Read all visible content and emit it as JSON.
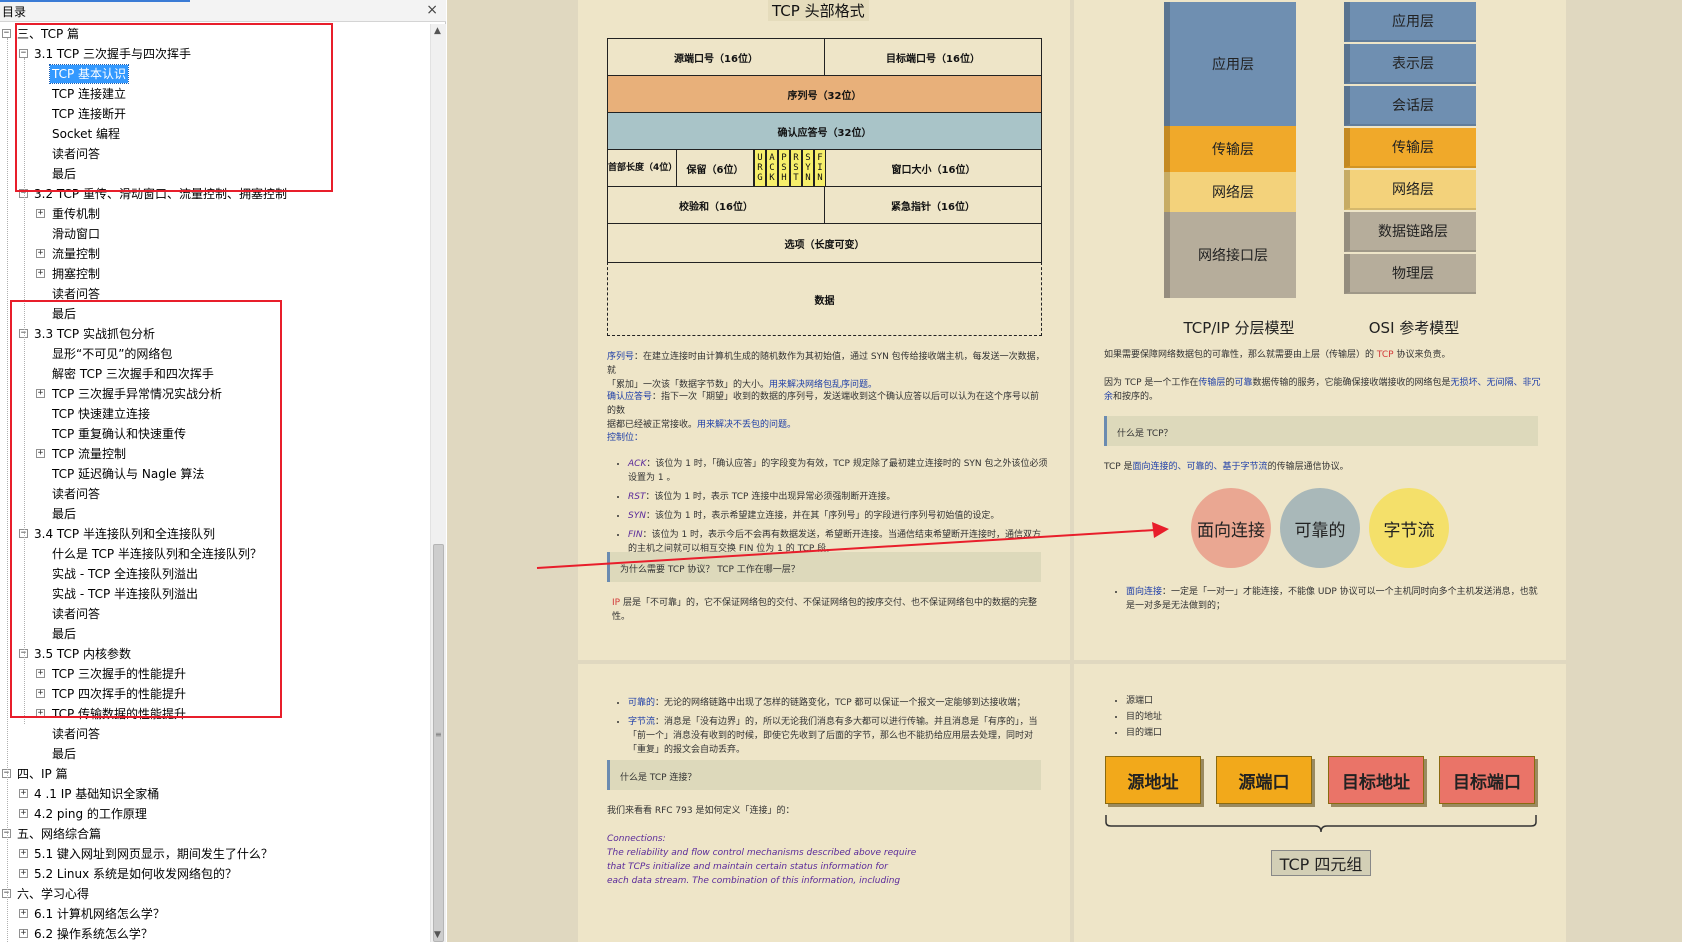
{
  "toc": {
    "title": "目录",
    "close": "×",
    "items": [
      {
        "id": "n0",
        "label": "三、TCP 篇",
        "level": 0,
        "exp": "−"
      },
      {
        "id": "n1",
        "label": "3.1 TCP 三次握手与四次挥手",
        "level": 1,
        "exp": "−"
      },
      {
        "id": "n2",
        "label": "TCP 基本认识",
        "level": 2,
        "exp": "",
        "selected": true
      },
      {
        "id": "n3",
        "label": "TCP 连接建立",
        "level": 2,
        "exp": ""
      },
      {
        "id": "n4",
        "label": "TCP 连接断开",
        "level": 2,
        "exp": ""
      },
      {
        "id": "n5",
        "label": "Socket 编程",
        "level": 2,
        "exp": ""
      },
      {
        "id": "n6",
        "label": "读者问答",
        "level": 2,
        "exp": ""
      },
      {
        "id": "n7",
        "label": "最后",
        "level": 2,
        "exp": ""
      },
      {
        "id": "n8",
        "label": "3.2 TCP 重传、滑动窗口、流量控制、拥塞控制",
        "level": 1,
        "exp": "−"
      },
      {
        "id": "n9",
        "label": "重传机制",
        "level": 2,
        "exp": "+"
      },
      {
        "id": "n10",
        "label": "滑动窗口",
        "level": 2,
        "exp": ""
      },
      {
        "id": "n11",
        "label": "流量控制",
        "level": 2,
        "exp": "+"
      },
      {
        "id": "n12",
        "label": "拥塞控制",
        "level": 2,
        "exp": "+"
      },
      {
        "id": "n13",
        "label": "读者问答",
        "level": 2,
        "exp": ""
      },
      {
        "id": "n14",
        "label": "最后",
        "level": 2,
        "exp": ""
      },
      {
        "id": "n15",
        "label": "3.3 TCP 实战抓包分析",
        "level": 1,
        "exp": "−"
      },
      {
        "id": "n16",
        "label": "显形“不可见”的网络包",
        "level": 2,
        "exp": ""
      },
      {
        "id": "n17",
        "label": "解密 TCP 三次握手和四次挥手",
        "level": 2,
        "exp": ""
      },
      {
        "id": "n18",
        "label": "TCP 三次握手异常情况实战分析",
        "level": 2,
        "exp": "+"
      },
      {
        "id": "n19",
        "label": "TCP 快速建立连接",
        "level": 2,
        "exp": ""
      },
      {
        "id": "n20",
        "label": "TCP 重复确认和快速重传",
        "level": 2,
        "exp": ""
      },
      {
        "id": "n21",
        "label": "TCP 流量控制",
        "level": 2,
        "exp": "+"
      },
      {
        "id": "n22",
        "label": "TCP 延迟确认与 Nagle 算法",
        "level": 2,
        "exp": ""
      },
      {
        "id": "n23",
        "label": "读者问答",
        "level": 2,
        "exp": ""
      },
      {
        "id": "n24",
        "label": "最后",
        "level": 2,
        "exp": ""
      },
      {
        "id": "n25",
        "label": "3.4 TCP 半连接队列和全连接队列",
        "level": 1,
        "exp": "−"
      },
      {
        "id": "n26",
        "label": "什么是 TCP 半连接队列和全连接队列？",
        "level": 2,
        "exp": ""
      },
      {
        "id": "n27",
        "label": "实战 - TCP 全连接队列溢出",
        "level": 2,
        "exp": ""
      },
      {
        "id": "n28",
        "label": "实战 - TCP 半连接队列溢出",
        "level": 2,
        "exp": ""
      },
      {
        "id": "n29",
        "label": "读者问答",
        "level": 2,
        "exp": ""
      },
      {
        "id": "n30",
        "label": "最后",
        "level": 2,
        "exp": ""
      },
      {
        "id": "n31",
        "label": "3.5 TCP 内核参数",
        "level": 1,
        "exp": "−"
      },
      {
        "id": "n32",
        "label": "TCP 三次握手的性能提升",
        "level": 2,
        "exp": "+"
      },
      {
        "id": "n33",
        "label": "TCP 四次挥手的性能提升",
        "level": 2,
        "exp": "+"
      },
      {
        "id": "n34",
        "label": "TCP 传输数据的性能提升",
        "level": 2,
        "exp": "+"
      },
      {
        "id": "n35",
        "label": "读者问答",
        "level": 2,
        "exp": ""
      },
      {
        "id": "n36",
        "label": "最后",
        "level": 2,
        "exp": ""
      },
      {
        "id": "n37",
        "label": "四、IP 篇",
        "level": 0,
        "exp": "−"
      },
      {
        "id": "n38",
        "label": "4 .1 IP 基础知识全家桶",
        "level": 1,
        "exp": "+"
      },
      {
        "id": "n39",
        "label": "4.2 ping 的工作原理",
        "level": 1,
        "exp": "+"
      },
      {
        "id": "n40",
        "label": "五、网络综合篇",
        "level": 0,
        "exp": "−"
      },
      {
        "id": "n41",
        "label": "5.1 键入网址到网页显示，期间发生了什么？",
        "level": 1,
        "exp": "+"
      },
      {
        "id": "n42",
        "label": "5.2 Linux 系统是如何收发网络包的？",
        "level": 1,
        "exp": "+"
      },
      {
        "id": "n43",
        "label": "六、学习心得",
        "level": 0,
        "exp": "−"
      },
      {
        "id": "n44",
        "label": "6.1 计算机网络怎么学？",
        "level": 1,
        "exp": "+"
      },
      {
        "id": "n45",
        "label": "6.2 操作系统怎么学？",
        "level": 1,
        "exp": "+"
      }
    ]
  },
  "page1": {
    "title": "TCP 头部格式",
    "header": {
      "src_port": "源端口号（16位）",
      "dst_port": "目标端口号（16位）",
      "seq": "序列号（32位）",
      "ack": "确认应答号（32位）",
      "hlen": "首部长度（4位）",
      "reserved": "保留（6位）",
      "flags_top": [
        "U",
        "A",
        "P",
        "R",
        "S",
        "F"
      ],
      "flags_mid": [
        "R",
        "C",
        "S",
        "S",
        "Y",
        "I"
      ],
      "flags_bot": [
        "G",
        "K",
        "H",
        "T",
        "N",
        "N"
      ],
      "window": "窗口大小（16位）",
      "checksum": "校验和（16位）",
      "urgent": "紧急指针（16位）",
      "options": "选项（长度可变）",
      "data": "数据"
    },
    "p_seq_term": "序列号",
    "p_seq_a": "：在建立连接时由计算机生成的随机数作为其初始值，通过 SYN 包传给接收端主机，每发送一次数据，就",
    "p_seq_b": "「累加」一次该「数据字节数」的大小。",
    "p_seq_link": "用来解决网络包乱序问题。",
    "p_ack_term": "确认应答号",
    "p_ack_a": "：指下一次「期望」收到的数据的序列号，发送端收到这个确认应答以后可以认为在这个序号以前的数",
    "p_ack_b": "据都已经被正常接收。",
    "p_ack_link": "用来解决不丢包的问题。",
    "ctrl_title": "控制位：",
    "ctrl": [
      {
        "k": "ACK",
        "t": "：该位为  1  时，「确认应答」的字段变为有效，TCP 规定除了最初建立连接时的  SYN  包之外该位必须设置为  1  。"
      },
      {
        "k": "RST",
        "t": "：该位为  1  时，表示 TCP 连接中出现异常必须强制断开连接。"
      },
      {
        "k": "SYN",
        "t": "：该位为  1  时，表示希望建立连接，并在其「序列号」的字段进行序列号初始值的设定。"
      },
      {
        "k": "FIN",
        "t": "：该位为  1  时，表示今后不会再有数据发送，希望断开连接。当通信结束希望断开连接时，通信双方的主机之间就可以相互交换  FIN  位为 1 的 TCP 段。"
      }
    ],
    "q1": "为什么需要 TCP 协议？ TCP 工作在哪一层？",
    "ip_term": "IP",
    "ip_text": "层是「不可靠」的，它不保证网络包的交付、不保证网络包的按序交付、也不保证网络包中的数据的完整性。"
  },
  "page2": {
    "tcpip_label": "TCP/IP 分层模型",
    "osi_label": "OSI 参考模型",
    "tcpip_layers": [
      "应用层",
      "传输层",
      "网络层",
      "网络接口层"
    ],
    "osi_layers": [
      "应用层",
      "表示层",
      "会话层",
      "传输层",
      "网络层",
      "数据链路层",
      "物理层"
    ],
    "para1_a": "如果需要保障网络数据包的可靠性，那么就需要由上层（传输层）的",
    "para1_tcp": "TCP",
    "para1_b": "协议来负责。",
    "para2_a": "因为 TCP 是一个工作在",
    "para2_b1": "传输层",
    "para2_b2": "的",
    "para2_b3": "可靠",
    "para2_c": "数据传输的服务，它能确保接收端接收的网络包是",
    "para2_d": "无损坏、无间隔、非冗余",
    "para2_e": "和按序的。",
    "q2": "什么是 TCP？",
    "def_a": "TCP 是",
    "def_b": "面向连接的、可靠的、基于字节流",
    "def_c": "的传输层通信协议。",
    "circles": [
      "面向连接",
      "可靠的",
      "字节流"
    ],
    "bullet_term": "面向连接",
    "bullet_text": "：一定是「一对一」才能连接，不能像 UDP 协议可以一个主机同时向多个主机发送消息，也就是一对多是无法做到的；"
  },
  "page3": {
    "b1_term": "可靠的",
    "b1_text": "：无论的网络链路中出现了怎样的链路变化，TCP 都可以保证一个报文一定能够到达接收端；",
    "b2_term": "字节流",
    "b2_text": "：消息是「没有边界」的，所以无论我们消息有多大都可以进行传输。并且消息是「有序的」，当「前一个」消息没有收到的时候，即使它先收到了后面的字节，那么也不能扔给应用层去处理，同时对「重复」的报文会自动丢弃。",
    "q3": "什么是 TCP 连接？",
    "rfc": "我们来看看 RFC 793 是如何定义「连接」的：",
    "quote_title": "Connections:",
    "quote_1": "The reliability and flow control mechanisms described above require",
    "quote_2": "that TCPs initialize and maintain certain status information for",
    "quote_3": "each data stream.  The combination of this information, including"
  },
  "page4": {
    "items": [
      "源端口",
      "目的地址",
      "目的端口"
    ],
    "tuples": [
      "源地址",
      "源端口",
      "目标地址",
      "目标端口"
    ],
    "tuple_label": "TCP 四元组"
  },
  "colors": {
    "highlight_red": "#e81e2b",
    "selected": "#3399ff",
    "seq_orange": "#e8b07a",
    "ack_blue": "#a9c4c8",
    "flag_yellow": "#f7ef6b",
    "app_blue": "#6f8fb1",
    "transport_orange": "#f0a92a",
    "network_yellow": "#f3d27b",
    "link_gray": "#b6ad9b",
    "circle_pink": "#eaa792",
    "circle_gray": "#a9b8b9",
    "circle_yellow": "#f4e06a",
    "tuple_orange": "#f2a91b",
    "tuple_red": "#ea7468"
  }
}
